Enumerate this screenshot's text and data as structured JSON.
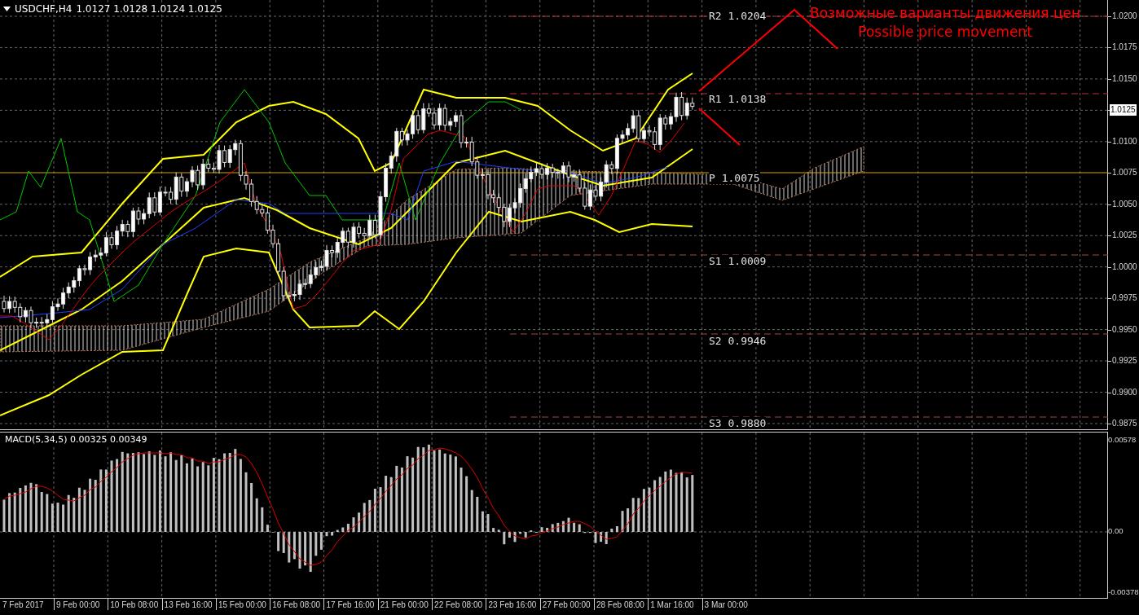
{
  "chart_header": {
    "symbol": "USDCHF,H4",
    "ohlc": "1.0127 1.0128 1.0124 1.0125"
  },
  "annotation": {
    "text_ru": "Возможные варианты движения цен",
    "text_en": "Possible price movement"
  },
  "pivot_levels": [
    {
      "label": "R2 1.0204",
      "kind": "resistance"
    },
    {
      "label": "R1 1.0138",
      "kind": "resistance"
    },
    {
      "label": "P 1.0075",
      "kind": "pivot"
    },
    {
      "label": "S1 1.0009",
      "kind": "support"
    },
    {
      "label": "S2 0.9946",
      "kind": "support"
    },
    {
      "label": "S3 0.9880",
      "kind": "support"
    }
  ],
  "price_axis": {
    "labels": [
      {
        "text": "1.0200",
        "current": false
      },
      {
        "text": "1.0175",
        "current": false
      },
      {
        "text": "1.0150",
        "current": false
      },
      {
        "text": "1.0125",
        "current": true
      },
      {
        "text": "1.0100",
        "current": false
      },
      {
        "text": "1.0075",
        "current": false
      },
      {
        "text": "1.0050",
        "current": false
      },
      {
        "text": "1.0025",
        "current": false
      },
      {
        "text": "1.0000",
        "current": false
      },
      {
        "text": "0.9975",
        "current": false
      },
      {
        "text": "0.9950",
        "current": false
      },
      {
        "text": "0.9925",
        "current": false
      },
      {
        "text": "0.9900",
        "current": false
      },
      {
        "text": "0.9875",
        "current": false
      }
    ]
  },
  "macd": {
    "label": "MACD(5,34,5) 0.00325 0.00349",
    "axis_labels": [
      "0.00578",
      "0.00",
      "-0.00378"
    ]
  },
  "time_axis": [
    "7 Feb 2017",
    "9 Feb 00:00",
    "10 Feb 08:00",
    "13 Feb 16:00",
    "15 Feb 00:00",
    "16 Feb 08:00",
    "17 Feb 16:00",
    "21 Feb 00:00",
    "22 Feb 08:00",
    "23 Feb 16:00",
    "27 Feb 00:00",
    "28 Feb 08:00",
    "1 Mar 16:00",
    "3 Mar 00:00"
  ]
}
